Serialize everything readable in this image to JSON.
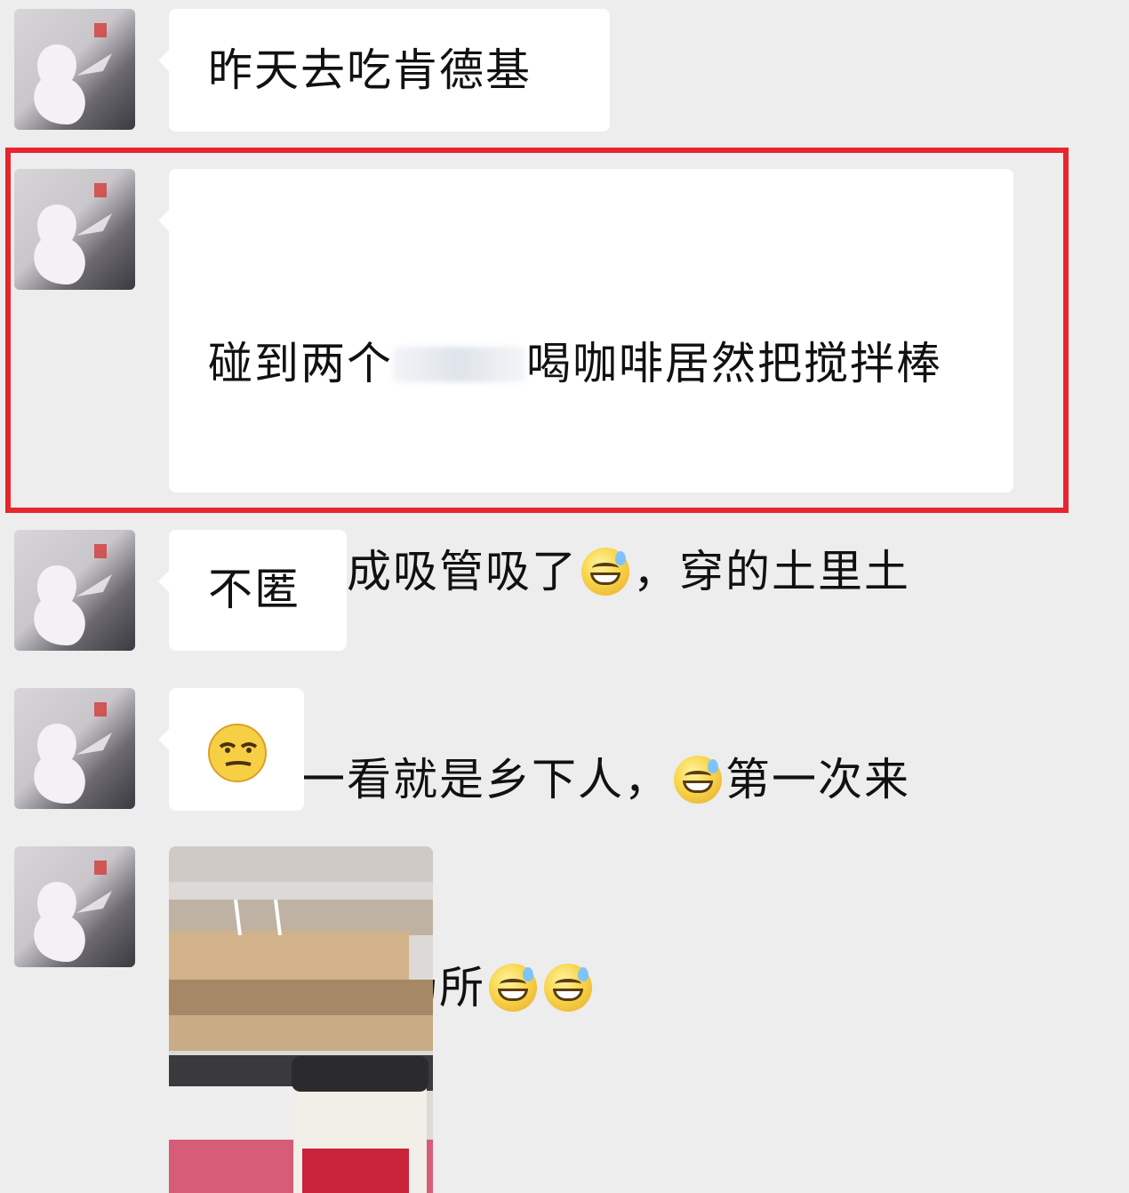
{
  "messages": [
    {
      "type": "text",
      "text": "昨天去吃肯德基"
    },
    {
      "type": "text",
      "highlighted": true,
      "segments": {
        "l1a": "碰到两个",
        "l1b": "喝咖啡居然把搅拌棒",
        "l2a": "当成当成吸管吸了",
        "l2b": "，穿的土里土",
        "l3a": "气的一看就是乡下人，",
        "l3b": "第一次来",
        "l4a": "这种高档场所"
      }
    },
    {
      "type": "text",
      "text": "不匿"
    },
    {
      "type": "emoji",
      "icon": "smirk-emoji"
    },
    {
      "type": "image",
      "description_icon": "kfc-photo"
    }
  ],
  "colors": {
    "highlight_border": "#e8242d",
    "chat_background": "#ededed",
    "bubble": "#ffffff"
  }
}
